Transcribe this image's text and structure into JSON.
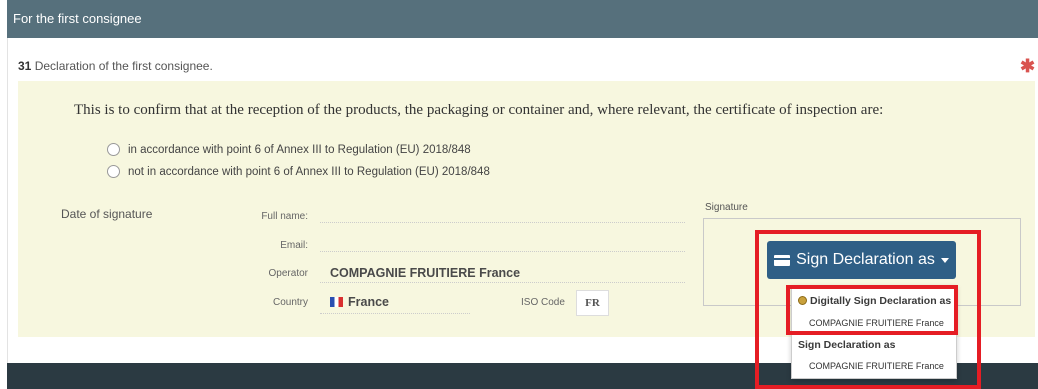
{
  "panel": {
    "title": "For the first consignee"
  },
  "box": {
    "number": "31",
    "title": "Declaration of the first consignee."
  },
  "confirm_text": "This is to confirm that at the reception of the products, the packaging or container and, where relevant, the certificate of inspection are:",
  "options": [
    {
      "label": "in accordance with point 6 of Annex III to Regulation (EU) 2018/848",
      "selected": false
    },
    {
      "label": "not in accordance with point 6 of Annex III to Regulation (EU) 2018/848",
      "selected": false
    }
  ],
  "fields": {
    "date_label": "Date of signature",
    "full_name_label": "Full name:",
    "full_name_value": "",
    "email_label": "Email:",
    "email_value": "",
    "operator_label": "Operator",
    "operator_value": "COMPAGNIE FRUITIERE France",
    "country_label": "Country",
    "country_value": "France",
    "iso_label": "ISO Code",
    "iso_value": "FR"
  },
  "signature": {
    "label": "Signature",
    "button_label": "Sign Declaration as",
    "menu": [
      {
        "header": "Digitally Sign Declaration as",
        "item": "COMPAGNIE FRUITIERE France",
        "icon": "seal-icon"
      },
      {
        "header": "Sign Declaration as",
        "item": "COMPAGNIE FRUITIERE France"
      }
    ]
  },
  "colors": {
    "header": "#56707c",
    "button": "#2f5f86",
    "highlight": "#e51d24",
    "form_bg": "#f7f7df"
  }
}
